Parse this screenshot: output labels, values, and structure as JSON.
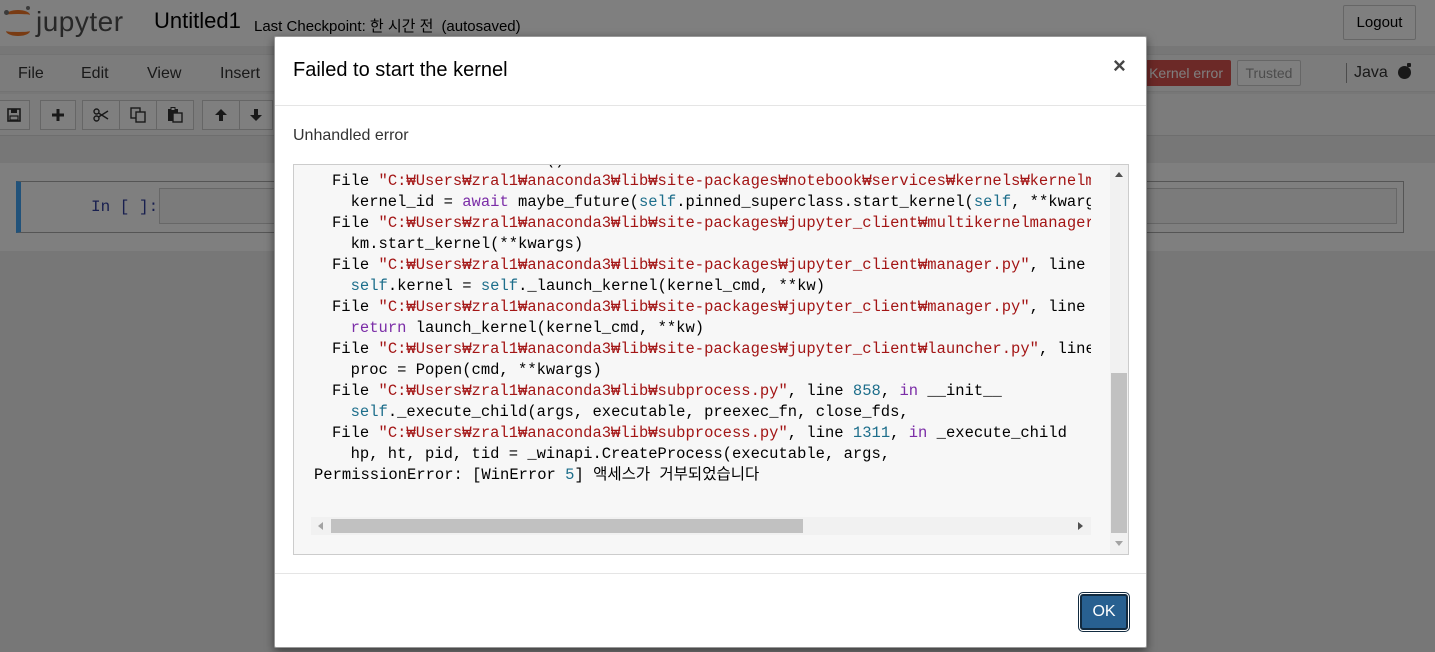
{
  "header": {
    "logo_text": "jupyter",
    "notebook_name": "Untitled1",
    "checkpoint": "Last Checkpoint: 한 시간 전",
    "autosaved": "(autosaved)",
    "logout_label": "Logout"
  },
  "menubar": {
    "items": [
      "File",
      "Edit",
      "View",
      "Insert"
    ],
    "kernel_error_label": "Kernel error",
    "trusted_label": "Trusted",
    "kernel_name": "Java"
  },
  "toolbar": {
    "buttons": [
      "save-icon",
      "plus-icon",
      "scissors-icon",
      "copy-icon",
      "paste-icon",
      "arrow-up-icon",
      "arrow-down-icon"
    ]
  },
  "cell": {
    "prompt": "In [ ]:"
  },
  "modal": {
    "title": "Failed to start the kernel",
    "close_symbol": "×",
    "message": "Unhandled error",
    "ok_label": "OK",
    "traceback": [
      [
        {
          "t": "  value = future.result()",
          "c": ""
        }
      ],
      [
        {
          "t": "File ",
          "c": ""
        },
        {
          "t": "\"C:₩Users₩zral1₩anaconda3₩lib₩site-packages₩notebook₩services₩kernels₩kernelmanager.py\"",
          "c": "s"
        }
      ],
      [
        {
          "t": "  kernel_id = ",
          "c": ""
        },
        {
          "t": "await",
          "c": "k"
        },
        {
          "t": " maybe_future(",
          "c": ""
        },
        {
          "t": "self",
          "c": "n"
        },
        {
          "t": ".pinned_superclass.start_kernel(",
          "c": ""
        },
        {
          "t": "self",
          "c": "n"
        },
        {
          "t": ", **kwargs)",
          "c": ""
        }
      ],
      [
        {
          "t": "File ",
          "c": ""
        },
        {
          "t": "\"C:₩Users₩zral1₩anaconda3₩lib₩site-packages₩jupyter_client₩multikernelmanager.py\"",
          "c": "s"
        }
      ],
      [
        {
          "t": "  km.start_kernel(**kwargs)",
          "c": ""
        }
      ],
      [
        {
          "t": "File ",
          "c": ""
        },
        {
          "t": "\"C:₩Users₩zral1₩anaconda3₩lib₩site-packages₩jupyter_client₩manager.py\"",
          "c": "s"
        },
        {
          "t": ", line ",
          "c": ""
        },
        {
          "t": "34",
          "c": "n"
        }
      ],
      [
        {
          "t": "  ",
          "c": ""
        },
        {
          "t": "self",
          "c": "n"
        },
        {
          "t": ".kernel = ",
          "c": ""
        },
        {
          "t": "self",
          "c": "n"
        },
        {
          "t": "._launch_kernel(kernel_cmd, **kw)",
          "c": ""
        }
      ],
      [
        {
          "t": "File ",
          "c": ""
        },
        {
          "t": "\"C:₩Users₩zral1₩anaconda3₩lib₩site-packages₩jupyter_client₩manager.py\"",
          "c": "s"
        },
        {
          "t": ", line ",
          "c": ""
        },
        {
          "t": "24",
          "c": "n"
        }
      ],
      [
        {
          "t": "  ",
          "c": ""
        },
        {
          "t": "return",
          "c": "k"
        },
        {
          "t": " launch_kernel(kernel_cmd, **kw)",
          "c": ""
        }
      ],
      [
        {
          "t": "File ",
          "c": ""
        },
        {
          "t": "\"C:₩Users₩zral1₩anaconda3₩lib₩site-packages₩jupyter_client₩launcher.py\"",
          "c": "s"
        },
        {
          "t": ", line ",
          "c": ""
        },
        {
          "t": "1",
          "c": "n"
        }
      ],
      [
        {
          "t": "  proc = Popen(cmd, **kwargs)",
          "c": ""
        }
      ],
      [
        {
          "t": "File ",
          "c": ""
        },
        {
          "t": "\"C:₩Users₩zral1₩anaconda3₩lib₩subprocess.py\"",
          "c": "s"
        },
        {
          "t": ", line ",
          "c": ""
        },
        {
          "t": "858",
          "c": "n"
        },
        {
          "t": ", ",
          "c": ""
        },
        {
          "t": "in",
          "c": "k"
        },
        {
          "t": " __init__",
          "c": ""
        }
      ],
      [
        {
          "t": "  ",
          "c": ""
        },
        {
          "t": "self",
          "c": "n"
        },
        {
          "t": "._execute_child(args, executable, preexec_fn, close_fds,",
          "c": ""
        }
      ],
      [
        {
          "t": "File ",
          "c": ""
        },
        {
          "t": "\"C:₩Users₩zral1₩anaconda3₩lib₩subprocess.py\"",
          "c": "s"
        },
        {
          "t": ", line ",
          "c": ""
        },
        {
          "t": "1311",
          "c": "n"
        },
        {
          "t": ", ",
          "c": ""
        },
        {
          "t": "in",
          "c": "k"
        },
        {
          "t": " _execute_child",
          "c": ""
        }
      ],
      [
        {
          "t": "  hp, ht, pid, tid = _winapi.CreateProcess(executable, args,",
          "c": ""
        }
      ],
      [
        {
          "t": "PermissionError: [WinError ",
          "c": "",
          "root": true
        },
        {
          "t": "5",
          "c": "n"
        },
        {
          "t": "] 액세스가 거부되었습니다",
          "c": ""
        }
      ]
    ]
  },
  "colors": {
    "kernel_error_bg": "#d9534f",
    "ok_button_bg": "#286090",
    "cell_border_accent": "#42a5f5",
    "string_color": "#a31515",
    "keyword_color": "#7b2da7",
    "number_color": "#1d6e8b"
  }
}
